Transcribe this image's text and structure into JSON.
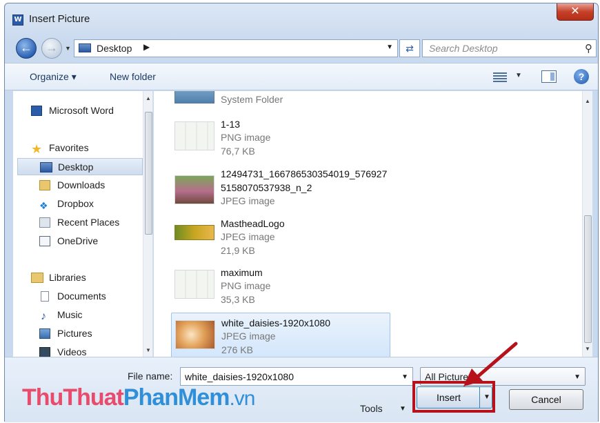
{
  "window": {
    "title": "Insert Picture",
    "app_icon": "word-icon",
    "close_glyph": "✕"
  },
  "address": {
    "location": "Desktop",
    "search_placeholder": "Search Desktop"
  },
  "toolbar": {
    "organize_label": "Organize",
    "new_folder_label": "New folder"
  },
  "nav": {
    "items": [
      {
        "label": "Microsoft Word",
        "icon": "word-icon"
      },
      {
        "label": "Favorites",
        "icon": "star-icon"
      },
      {
        "label": "Desktop",
        "icon": "desktop-icon",
        "selected": true
      },
      {
        "label": "Downloads",
        "icon": "downloads-folder-icon"
      },
      {
        "label": "Dropbox",
        "icon": "dropbox-icon"
      },
      {
        "label": "Recent Places",
        "icon": "recent-places-icon"
      },
      {
        "label": "OneDrive",
        "icon": "onedrive-icon"
      },
      {
        "label": "Libraries",
        "icon": "libraries-icon"
      },
      {
        "label": "Documents",
        "icon": "documents-icon"
      },
      {
        "label": "Music",
        "icon": "music-icon"
      },
      {
        "label": "Pictures",
        "icon": "pictures-icon"
      },
      {
        "label": "Videos",
        "icon": "videos-icon"
      }
    ]
  },
  "files": [
    {
      "name": "System Folder",
      "type": "",
      "size": ""
    },
    {
      "name": "1-13",
      "type": "PNG image",
      "size": "76,7 KB"
    },
    {
      "name": "12494731_166786530354019_576927\n5158070537938_n_2",
      "type": "JPEG image",
      "size": ""
    },
    {
      "name": "MastheadLogo",
      "type": "JPEG image",
      "size": "21,9 KB"
    },
    {
      "name": "maximum",
      "type": "PNG image",
      "size": "35,3 KB"
    },
    {
      "name": "white_daisies-1920x1080",
      "type": "JPEG image",
      "size": "276 KB",
      "selected": true
    }
  ],
  "footer": {
    "file_name_label": "File name:",
    "file_name_value": "white_daisies-1920x1080",
    "filter_value": "All Pictures",
    "tools_label": "Tools",
    "insert_label": "Insert",
    "cancel_label": "Cancel"
  },
  "watermark": {
    "part1": "ThuThuat",
    "part2": "PhanMem",
    "part3": ".vn"
  },
  "colors": {
    "highlight": "#b5121b",
    "selection": "#d3e6fb",
    "accent": "#2c62b5"
  }
}
